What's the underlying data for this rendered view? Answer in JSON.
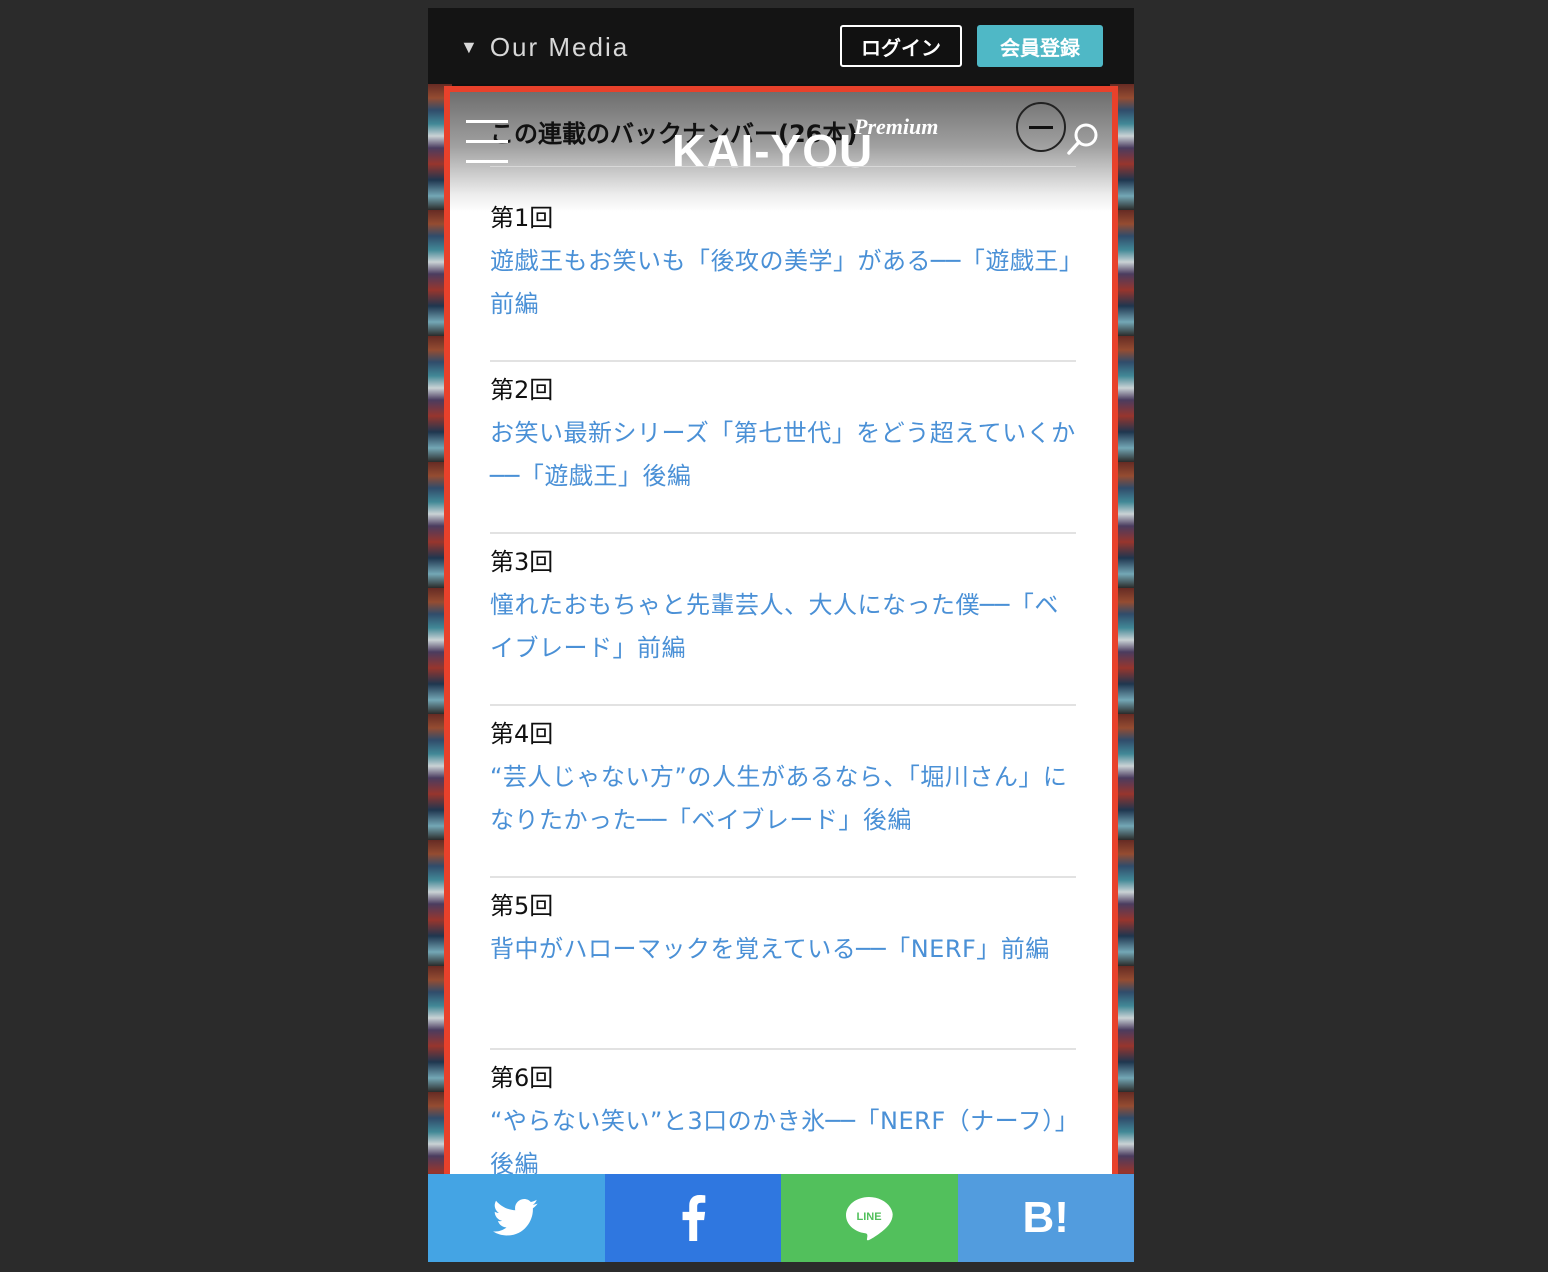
{
  "topbar": {
    "our_media": "Our Media",
    "login": "ログイン",
    "register": "会員登録"
  },
  "header": {
    "backnumber_title": "この連載のバックナンバー(26本)",
    "logo": "KAI-YOU",
    "premium": "Premium"
  },
  "items": [
    {
      "episode": "第1回",
      "title": "遊戯王もお笑いも「後攻の美学」がある──「遊戯王」前編"
    },
    {
      "episode": "第2回",
      "title": "お笑い最新シリーズ「第七世代」をどう超えていくか──「遊戯王」後編"
    },
    {
      "episode": "第3回",
      "title": "憧れたおもちゃと先輩芸人、大人になった僕──「ベイブレード」前編"
    },
    {
      "episode": "第4回",
      "title": "“芸人じゃない方”の人生があるなら、「堀川さん」になりたかった──「ベイブレード」後編"
    },
    {
      "episode": "第5回",
      "title": "背中がハローマックを覚えている──「NERF」前編"
    },
    {
      "episode": "第6回",
      "title": "“やらない笑い”と3口のかき氷──「NERF（ナーフ）」後編"
    }
  ],
  "share": {
    "line_label": "LINE",
    "hatena_label": "B!"
  },
  "colors": {
    "highlight_border": "#e8412b",
    "link": "#4a90d6",
    "register": "#4fb8c6",
    "twitter": "#44a4e4",
    "facebook": "#2f77e0",
    "line": "#52c05c",
    "hatena": "#529cde"
  }
}
